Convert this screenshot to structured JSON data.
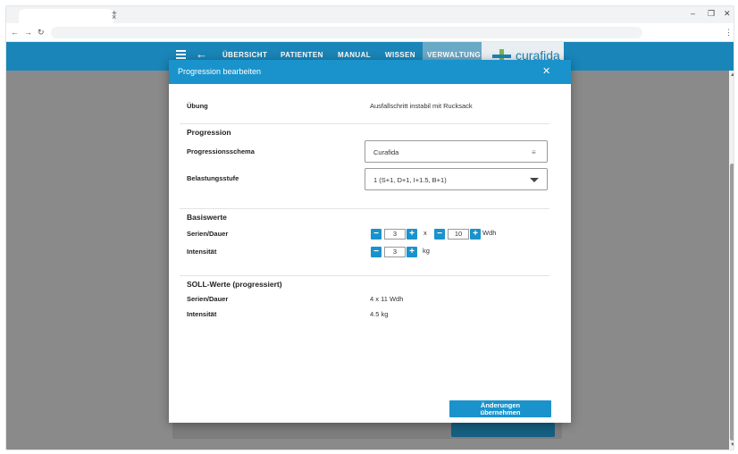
{
  "browser": {
    "tab_close": "×",
    "new_tab": "+",
    "minimize": "–",
    "maximize": "❐",
    "close": "✕",
    "back": "←",
    "forward": "→",
    "reload": "↻",
    "menu": "⋮"
  },
  "header": {
    "back_icon": "←",
    "nav": [
      "ÜBERSICHT",
      "PATIENTEN",
      "MANUAL",
      "WISSEN",
      "VERWALTUNG"
    ],
    "active_nav": "VERWALTUNG",
    "logo_text": "curafida",
    "color": "#1a85b8"
  },
  "modal": {
    "title": "Progression bearbeiten",
    "close": "✕",
    "exercise_label": "Übung",
    "exercise_value": "Ausfallschritt instabil mit Rucksack",
    "progression": {
      "title": "Progression",
      "scheme_label": "Progressionsschema",
      "scheme_value": "Curafida",
      "level_label": "Belastungsstufe",
      "level_value": "1 (S+1, D+1, I+1.5, B+1)"
    },
    "base": {
      "title": "Basiswerte",
      "series_label": "Serien/Dauer",
      "series_value": "3",
      "times": "x",
      "reps_value": "10",
      "reps_unit": "Wdh",
      "intensity_label": "Intensität",
      "intensity_value": "3",
      "intensity_unit": "kg",
      "minus": "−",
      "plus": "+"
    },
    "target": {
      "title": "SOLL-Werte (progressiert)",
      "series_label": "Serien/Dauer",
      "series_value": "4 x 11 Wdh",
      "intensity_label": "Intensität",
      "intensity_value": "4.5 kg"
    },
    "apply_line1": "Änderungen",
    "apply_line2": "übernehmen",
    "accent": "#1a93cc"
  }
}
